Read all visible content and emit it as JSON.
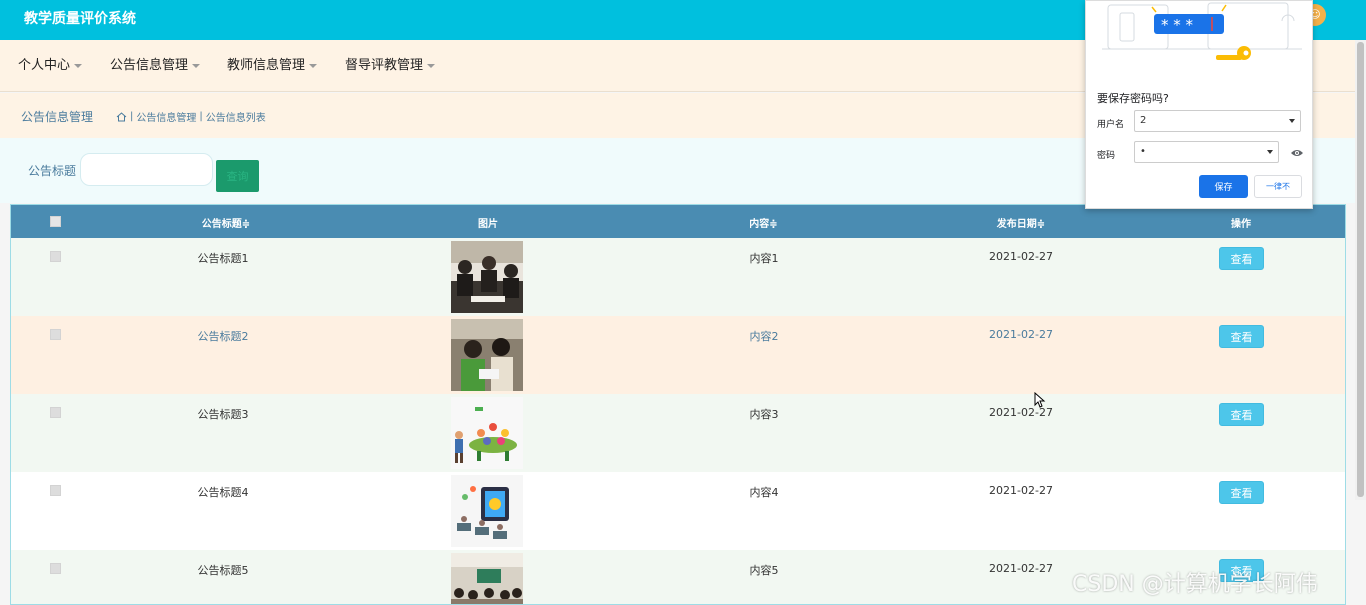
{
  "app": {
    "title": "教学质量评价系统"
  },
  "menu": [
    {
      "label": "个人中心"
    },
    {
      "label": "公告信息管理"
    },
    {
      "label": "教师信息管理"
    },
    {
      "label": "督导评教管理"
    }
  ],
  "breadcrumb": {
    "head": "公告信息管理",
    "trail": [
      "公告信息管理",
      "公告信息列表"
    ]
  },
  "search": {
    "label": "公告标题",
    "placeholder": "",
    "value": "",
    "button": "查询"
  },
  "table": {
    "columns": [
      "公告标题≑",
      "图片",
      "内容≑",
      "发布日期≑",
      "操作"
    ],
    "rows": [
      {
        "title": "公告标题1",
        "content": "内容1",
        "date": "2021-02-27",
        "action": "查看"
      },
      {
        "title": "公告标题2",
        "content": "内容2",
        "date": "2021-02-27",
        "action": "查看"
      },
      {
        "title": "公告标题3",
        "content": "内容3",
        "date": "2021-02-27",
        "action": "查看"
      },
      {
        "title": "公告标题4",
        "content": "内容4",
        "date": "2021-02-27",
        "action": "查看"
      },
      {
        "title": "公告标题5",
        "content": "内容5",
        "date": "2021-02-27",
        "action": "查看"
      }
    ]
  },
  "password_popup": {
    "title": "要保存密码吗?",
    "username_label": "用户名",
    "username_value": "2",
    "password_label": "密码",
    "password_value": "•",
    "save_button": "保存",
    "never_button": "一律不"
  },
  "colors": {
    "header": "#00c0de",
    "menu_bg": "#fef3e5",
    "table_head": "#4a8cb2",
    "view_button": "#4dc6ea"
  },
  "watermark": "CSDN @计算机学长阿伟"
}
